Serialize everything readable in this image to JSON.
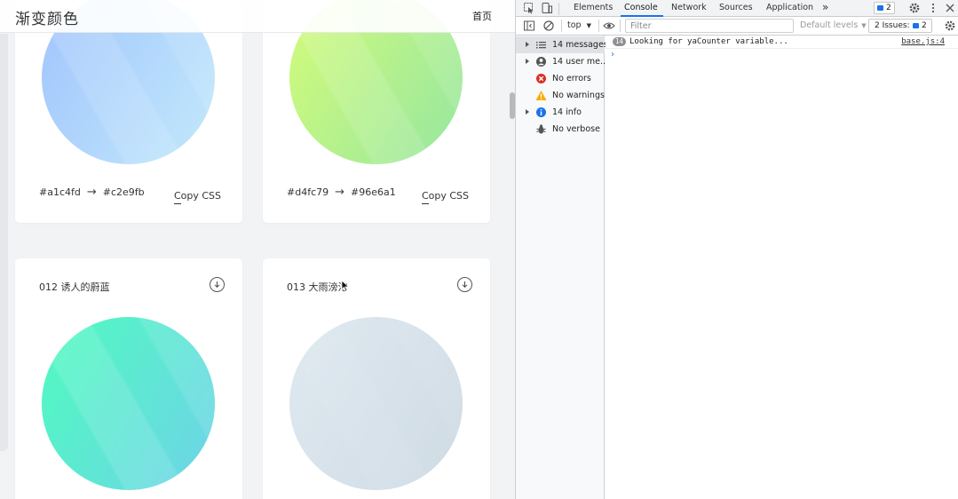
{
  "site": {
    "title": "渐变颜色",
    "nav_home": "首页"
  },
  "cards": [
    {
      "name": "",
      "from": "#a1c4fd",
      "to": "#c2e9fb",
      "arrow": "→",
      "copy_label": "Copy CSS",
      "gradient": [
        "#a1c4fd",
        "#c2e9fb"
      ]
    },
    {
      "name": "",
      "from": "#d4fc79",
      "to": "#96e6a1",
      "arrow": "→",
      "copy_label": "Copy CSS",
      "gradient": [
        "#d4fc79",
        "#96e6a1"
      ]
    },
    {
      "name": "012 诱人的蔚蓝",
      "gradient": [
        "#4ffbbf",
        "#6ed3e8"
      ]
    },
    {
      "name": "013 大雨滂沱",
      "gradient": [
        "#dfe9f0",
        "#cfdbe4"
      ]
    }
  ],
  "devtools": {
    "tabs": [
      "Elements",
      "Console",
      "Network",
      "Sources",
      "Application"
    ],
    "more_tabs": "»",
    "active_tab": "Console",
    "issues_badge_count": "2",
    "toolbar": {
      "context": "top",
      "filter_placeholder": "Filter",
      "levels": "Default levels",
      "issues_label": "2 Issues:",
      "issues_count": "2"
    },
    "sidebar": [
      {
        "label": "14 messages",
        "icon": "list-icon",
        "expandable": true
      },
      {
        "label": "14 user me...",
        "icon": "user-icon",
        "expandable": true
      },
      {
        "label": "No errors",
        "icon": "error-icon",
        "expandable": false
      },
      {
        "label": "No warnings",
        "icon": "warning-icon",
        "expandable": false
      },
      {
        "label": "14 info",
        "icon": "info-icon",
        "expandable": true
      },
      {
        "label": "No verbose",
        "icon": "bug-icon",
        "expandable": false
      }
    ],
    "messages": [
      {
        "count": "14",
        "text": "Looking for yaCounter variable...",
        "source": "base.js:4"
      }
    ],
    "prompt": "›"
  },
  "colors": {
    "accent": "#1a73e8",
    "error": "#d93025",
    "warning": "#f9ab00",
    "info": "#1a73e8"
  }
}
